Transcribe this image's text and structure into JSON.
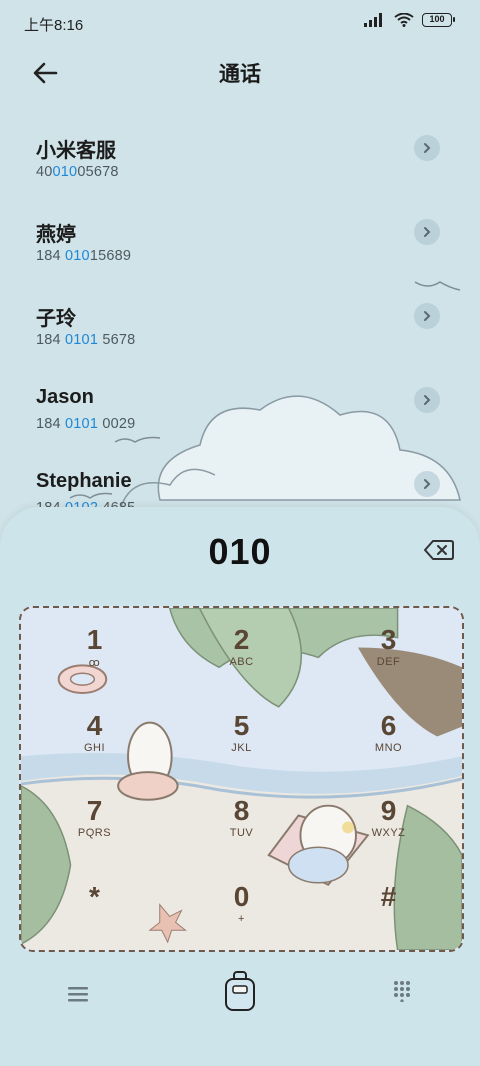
{
  "status_bar": {
    "time": "上午8:16",
    "battery": "100"
  },
  "header": {
    "title": "通话"
  },
  "contacts": [
    {
      "name": "小米客服",
      "num_pre": "40",
      "num_hl": "010",
      "num_post": "05678"
    },
    {
      "name": "燕婷",
      "num_pre": "184 ",
      "num_hl": "010",
      "num_post": "15689"
    },
    {
      "name": "子玲",
      "num_pre": "184 ",
      "num_hl": "0101",
      "num_post": " 5678"
    },
    {
      "name": "Jason",
      "num_pre": "184 ",
      "num_hl": "0101",
      "num_post": " 0029"
    },
    {
      "name": "Stephanie",
      "num_pre": "184 ",
      "num_hl": "0102",
      "num_post": " 4685"
    }
  ],
  "dialer": {
    "input": "010"
  },
  "keys": [
    {
      "digit": "1",
      "letters": "ꝏ"
    },
    {
      "digit": "2",
      "letters": "ABC"
    },
    {
      "digit": "3",
      "letters": "DEF"
    },
    {
      "digit": "4",
      "letters": "GHI"
    },
    {
      "digit": "5",
      "letters": "JKL"
    },
    {
      "digit": "6",
      "letters": "MNO"
    },
    {
      "digit": "7",
      "letters": "PQRS"
    },
    {
      "digit": "8",
      "letters": "TUV"
    },
    {
      "digit": "9",
      "letters": "WXYZ"
    },
    {
      "digit": "*",
      "letters": ""
    },
    {
      "digit": "0",
      "letters": "+"
    },
    {
      "digit": "#",
      "letters": ""
    }
  ],
  "icons": {
    "back": "arrow-left-icon",
    "chevron": "chevron-right-icon",
    "backspace": "backspace-icon",
    "menu": "menu-icon",
    "call": "call-icon",
    "dialpad": "dialpad-icon"
  },
  "colors": {
    "highlight": "#1e88d8",
    "key_ink": "#5a4634",
    "background": "#cfe3e8"
  }
}
